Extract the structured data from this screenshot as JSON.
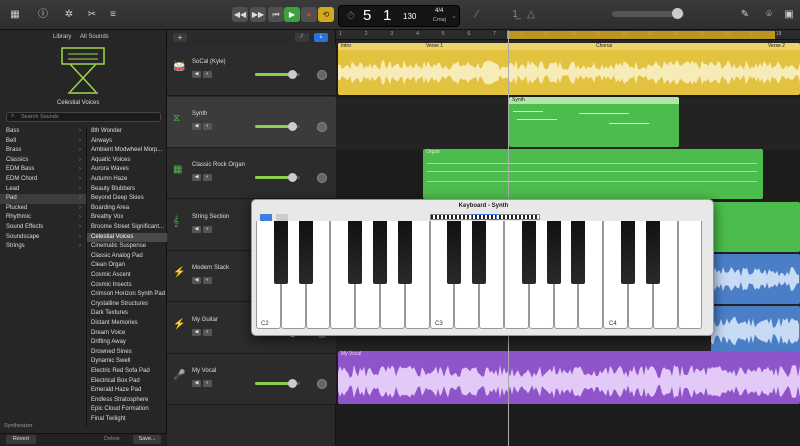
{
  "toolbar": {
    "bar": "5",
    "beat": "1",
    "tempo": "130",
    "tempo_label": "KEY",
    "sig_top": "4/4",
    "sig_key": "Cmaj"
  },
  "library": {
    "title": "Library",
    "filter": "All Sounds",
    "patch_name": "Celestial Voices",
    "search_placeholder": "Search Sounds",
    "footer_label": "Synthesizer",
    "btn_revert": "Revert",
    "btn_delete": "Delete",
    "btn_save": "Save...",
    "categories": [
      "Bass",
      "Bell",
      "Brass",
      "Classics",
      "EDM Bass",
      "EDM Chord",
      "Lead",
      "Pad",
      "Plucked",
      "Rhythmic",
      "Sound Effects",
      "Soundscape",
      "Strings"
    ],
    "patches": [
      "8th Wonder",
      "Airways",
      "Ambient Modwheel Morp...",
      "Aquatic Voices",
      "Aurora Waves",
      "Autumn Haze",
      "Beauty Blubbers",
      "Beyond Deep Skies",
      "Boarding Area",
      "Breathy Vox",
      "Broome Street Significant...",
      "Celestial Voices",
      "Cinematic Suspense",
      "Classic Analog Pad",
      "Clean Organ",
      "Cosmic Ascent",
      "Cosmic Insects",
      "Crimson Horizon Synth Pad",
      "Crystalline Structures",
      "Dark Textures",
      "Distant Memories",
      "Dream Voice",
      "Drifting Away",
      "Drowned Sines",
      "Dynamic Swell",
      "Electric Red Sofa Pad",
      "Electrical Box Pad",
      "Emerald Haze Pad",
      "Endless Stratosphere",
      "Epic Cloud Formation",
      "Final Twilight"
    ]
  },
  "tracks": [
    {
      "name": "SoCal (Kyle)"
    },
    {
      "name": "Synth"
    },
    {
      "name": "Classic Rock Organ"
    },
    {
      "name": "String Section"
    },
    {
      "name": "Modern Stack"
    },
    {
      "name": "My Guitar"
    },
    {
      "name": "My Vocal"
    }
  ],
  "ruler": {
    "labels": [
      "1",
      "2",
      "3",
      "4",
      "5",
      "6",
      "7",
      "8",
      "9",
      "10",
      "11",
      "12",
      "13",
      "14",
      "15",
      "16",
      "17",
      "18",
      "19"
    ]
  },
  "regions": {
    "intro": "Intro",
    "verse1": "Verse 1",
    "chorus": "Chorus",
    "verse2": "Verse 2",
    "synth": "Synth",
    "organ": "Organ",
    "vocal": "My Vocal"
  },
  "keyboard": {
    "title": "Keyboard - Synth",
    "c2": "C2",
    "c3": "C3",
    "c4": "C4"
  },
  "colors": {
    "yellow": "#e2c23f",
    "green": "#4cbc4c",
    "blue": "#4a7fc8",
    "purple": "#8f54c9"
  }
}
